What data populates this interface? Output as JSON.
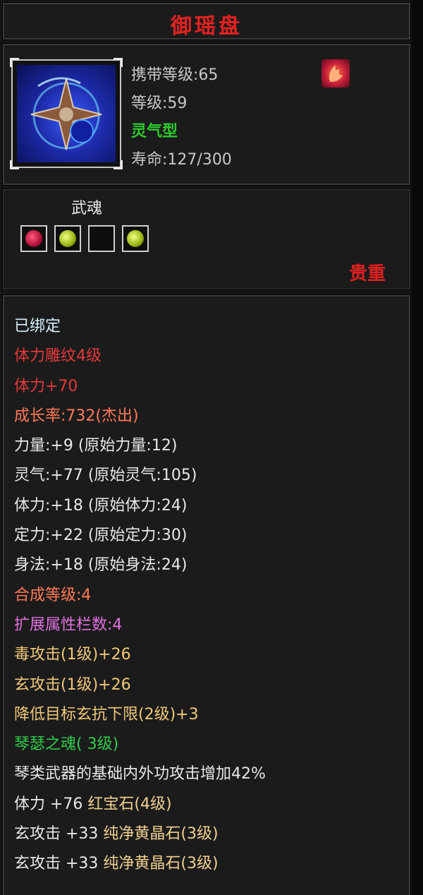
{
  "window": {
    "title": "御瑶盘"
  },
  "item": {
    "carry_level": "携带等级:65",
    "level": "等级:59",
    "type": "灵气型",
    "lifespan": "寿命:127/300",
    "icon": "spinning-blade-disc-icon",
    "type_icon": "flame-feather-icon"
  },
  "soul": {
    "label": "武魂",
    "slots": [
      {
        "gem": "red-gem-icon"
      },
      {
        "gem": "gold-gem-icon"
      },
      {
        "gem": "empty-slot"
      },
      {
        "gem": "gold-gem-icon"
      }
    ],
    "rarity": "贵重"
  },
  "stats": [
    {
      "text": "已绑定",
      "color": "#d8f0ff"
    },
    {
      "text": "体力雕纹4级",
      "color": "#e03a3a"
    },
    {
      "text": "体力+70",
      "color": "#e03a3a"
    },
    {
      "text": "成长率:732(杰出)",
      "color": "#ff7a55"
    },
    {
      "text": "力量:+9 (原始力量:12)",
      "color": "#e8e8e8"
    },
    {
      "text": "灵气:+77 (原始灵气:105)",
      "color": "#e8e8e8"
    },
    {
      "text": "体力:+18 (原始体力:24)",
      "color": "#e8e8e8"
    },
    {
      "text": "定力:+22 (原始定力:30)",
      "color": "#e8e8e8"
    },
    {
      "text": "身法:+18 (原始身法:24)",
      "color": "#e8e8e8"
    },
    {
      "text": "合成等级:4",
      "color": "#ff7a55"
    },
    {
      "text": "扩展属性栏数:4",
      "color": "#e070e0"
    },
    {
      "text": "毒攻击(1级)+26",
      "color": "#f0c878"
    },
    {
      "text": "玄攻击(1级)+26",
      "color": "#f0c878"
    },
    {
      "text": "降低目标玄抗下限(2级)+3",
      "color": "#f0c878"
    },
    {
      "text": "琴瑟之魂( 3级)",
      "color": "#2ecc4a"
    },
    {
      "text": "琴类武器的基础内外功攻击增加42%",
      "color": "#e8e8e8"
    },
    {
      "parts": [
        {
          "text": "体力 +76 ",
          "color": "#e8e8e8"
        },
        {
          "text": "红宝石(4级)",
          "color": "#f0d090"
        }
      ]
    },
    {
      "parts": [
        {
          "text": "玄攻击 +33 ",
          "color": "#e8e8e8"
        },
        {
          "text": "纯净黄晶石(3级)",
          "color": "#f0d090"
        }
      ]
    },
    {
      "parts": [
        {
          "text": "玄攻击 +33 ",
          "color": "#e8e8e8"
        },
        {
          "text": "纯净黄晶石(3级)",
          "color": "#f0d090"
        }
      ]
    }
  ]
}
